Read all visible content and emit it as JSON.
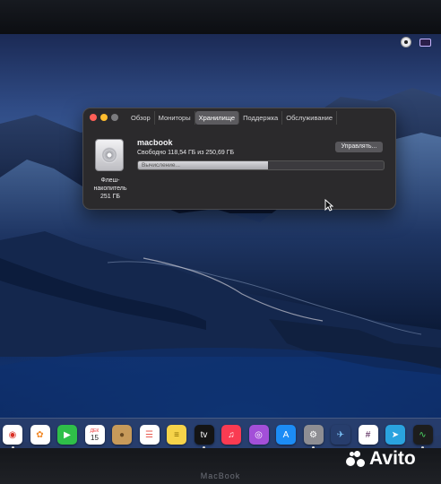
{
  "menubar": {
    "icons": [
      "status-user-icon",
      "input-source-icon"
    ]
  },
  "window": {
    "tabs": [
      {
        "label": "Обзор",
        "active": false
      },
      {
        "label": "Мониторы",
        "active": false
      },
      {
        "label": "Хранилище",
        "active": true
      },
      {
        "label": "Поддержка",
        "active": false
      },
      {
        "label": "Обслуживание",
        "active": false
      }
    ],
    "disk": {
      "label": "Флеш-\nнакопитель\n251 ГБ",
      "name": "macbook",
      "free_text": "Свободно 118,54 ГБ из 250,69 ГБ",
      "manage_label": "Управлять...",
      "usage_status": "Вычисление...",
      "usage_fraction": 0.53
    }
  },
  "dock": {
    "items": [
      {
        "name": "chrome-icon",
        "glyph": "◉",
        "bg": "#ffffff",
        "fg": "#d93025"
      },
      {
        "name": "photos-icon",
        "glyph": "✿",
        "bg": "#ffffff",
        "fg": "#f28b2c"
      },
      {
        "name": "facetime-icon",
        "glyph": "▶",
        "bg": "#2fbf49",
        "fg": "#ffffff"
      },
      {
        "name": "calendar-icon",
        "glyph": "15",
        "bg": "#ffffff",
        "fg": "#222222",
        "caption": "ДЕК"
      },
      {
        "name": "contacts-icon",
        "glyph": "●",
        "bg": "#c79a5a",
        "fg": "#6b4b22"
      },
      {
        "name": "reminders-icon",
        "glyph": "☰",
        "bg": "#ffffff",
        "fg": "#e85a4f"
      },
      {
        "name": "notes-icon",
        "glyph": "≡",
        "bg": "#f6d34a",
        "fg": "#8a6c00"
      },
      {
        "name": "tv-icon",
        "glyph": "tv",
        "bg": "#141414",
        "fg": "#ffffff"
      },
      {
        "name": "music-icon",
        "glyph": "♫",
        "bg": "#fa3b52",
        "fg": "#ffffff"
      },
      {
        "name": "podcasts-icon",
        "glyph": "◎",
        "bg": "#a34fd8",
        "fg": "#ffffff"
      },
      {
        "name": "app-store-icon",
        "glyph": "A",
        "bg": "#1c8cf5",
        "fg": "#ffffff"
      },
      {
        "name": "system-preferences-icon",
        "glyph": "⚙",
        "bg": "#8e8e93",
        "fg": "#ffffff"
      },
      {
        "name": "migration-bird-icon",
        "glyph": "✈",
        "bg": "transparent",
        "fg": "#7ec8ff"
      },
      {
        "name": "slack-icon",
        "glyph": "#",
        "bg": "#ffffff",
        "fg": "#4a154b"
      },
      {
        "name": "telegram-icon",
        "glyph": "➤",
        "bg": "#2aa3df",
        "fg": "#ffffff"
      },
      {
        "name": "activity-monitor-icon",
        "glyph": "∿",
        "bg": "#1d1d1d",
        "fg": "#4cd964"
      }
    ]
  },
  "bezel": {
    "brand": "MacBook"
  },
  "watermark": {
    "text": "Avito"
  }
}
